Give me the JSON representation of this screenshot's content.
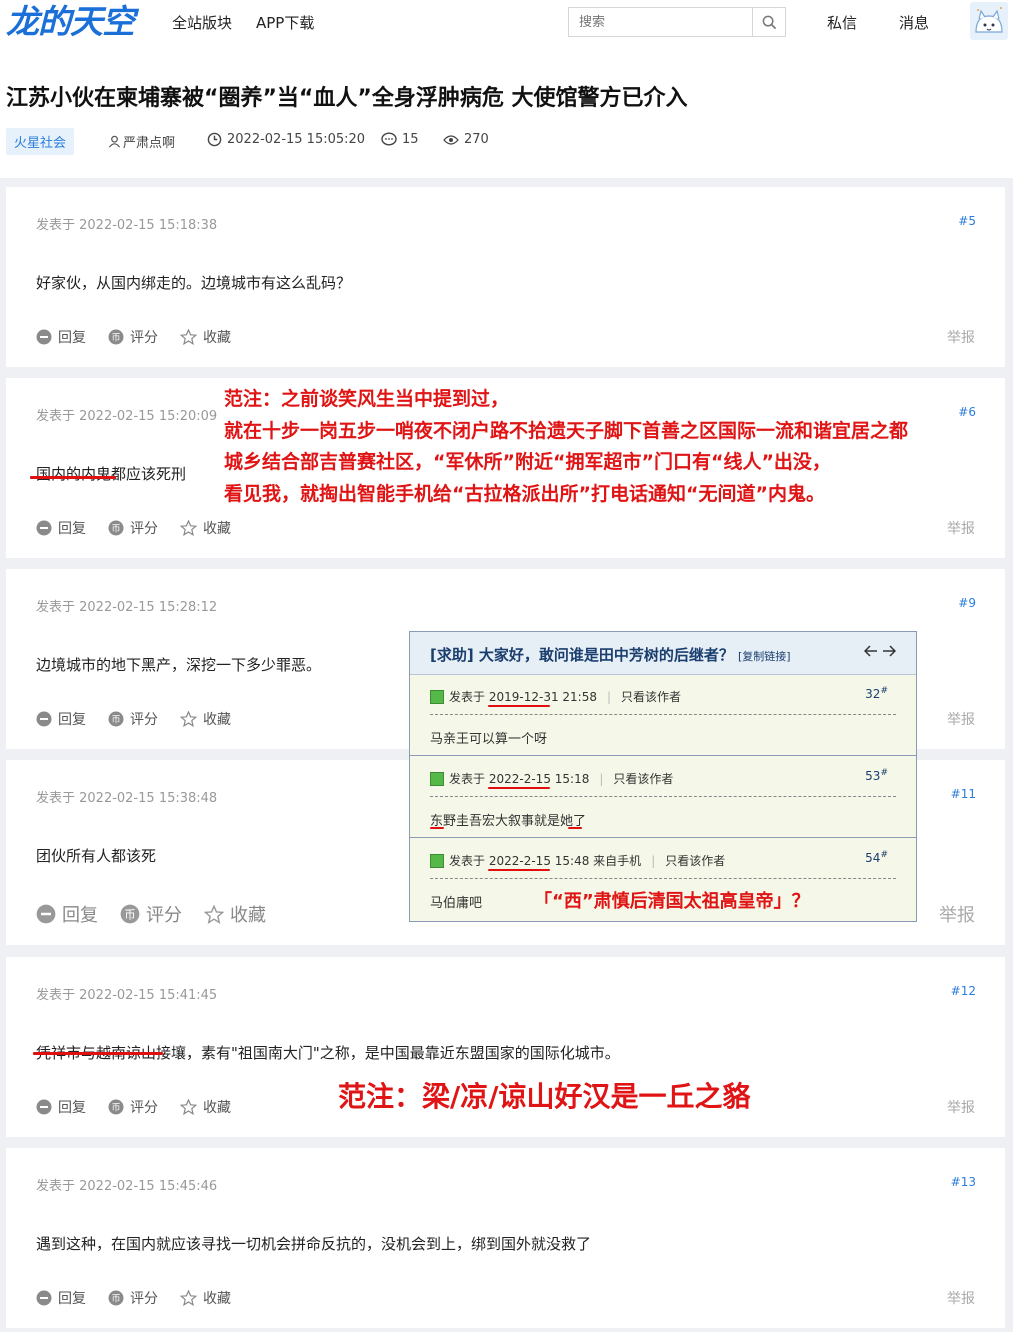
{
  "site": {
    "logo": "龙的天空",
    "nav": [
      "全站版块",
      "APP下载"
    ],
    "search_placeholder": "搜索",
    "top_links": [
      "私信",
      "消息"
    ]
  },
  "thread": {
    "title": "江苏小伙在柬埔寨被“圈养”当“血人”全身浮肿病危 大使馆警方已介入",
    "tag": "火星社会",
    "author": "严肃点啊",
    "time": "2022-02-15 15:05:20",
    "comments": "15",
    "views": "270"
  },
  "actions": {
    "reply": "回复",
    "rate": "评分",
    "fav": "收藏",
    "report": "举报"
  },
  "posts": [
    {
      "time": "发表于 2022-02-15 15:18:38",
      "floor": "#5",
      "content": "好家伙，从国内绑走的。边境城市有这么乱码？"
    },
    {
      "time": "发表于 2022-02-15 15:20:09",
      "floor": "#6",
      "content": "国内的内鬼都应该死刑"
    },
    {
      "time": "发表于 2022-02-15 15:28:12",
      "floor": "#9",
      "content": "边境城市的地下黑产，深挖一下多少罪恶。"
    },
    {
      "time": "发表于 2022-02-15 15:38:48",
      "floor": "#11",
      "content": "团伙所有人都该死"
    },
    {
      "time": "发表于 2022-02-15 15:41:45",
      "floor": "#12",
      "content": "凭祥市与越南谅山接壤，素有\"祖国南大门\"之称，是中国最靠近东盟国家的国际化城市。"
    },
    {
      "time": "发表于 2022-02-15 15:45:46",
      "floor": "#13",
      "content": "遇到这种，在国内就应该寻找一切机会拼命反抗的，没机会到上，绑到国外就没救了"
    }
  ],
  "notes": {
    "note1": [
      "范注：之前谈笑风生当中提到过，",
      "就在十步一岗五步一哨夜不闭户路不拾遗天子脚下首善之区国际一流和谐宜居之都",
      "城乡结合部吉普赛社区，“军休所”附近“拥军超市”门口有“线人”出没，",
      "看见我，就掏出智能手机给“古拉格派出所”打电话通知“无间道”内鬼。"
    ],
    "note2": "范注：梁/凉/谅山好汉是一丘之貉",
    "note3": "「“西”肃慎后清国太祖高皇帝」？"
  },
  "inset": {
    "title": "[求助] 大家好，敢问谁是田中芳树的后继者？",
    "copy_link": "[复制链接]",
    "replies": [
      {
        "posted": "发表于",
        "time": "2019-12-31 21:58",
        "extra": "",
        "author_only": "只看该作者",
        "num": "32",
        "body": "马亲王可以算一个呀"
      },
      {
        "posted": "发表于",
        "time": "2022-2-15 15:18",
        "extra": "",
        "author_only": "只看该作者",
        "num": "53",
        "body": "东野圭吾宏大叙事就是她了"
      },
      {
        "posted": "发表于",
        "time": "2022-2-15 15:48",
        "extra": "来自手机",
        "author_only": "只看该作者",
        "num": "54",
        "body": "马伯庸吧"
      }
    ]
  },
  "colors": {
    "accent": "#2b7ddb",
    "annotation": "#e01414",
    "logo": "#1a6fd8"
  }
}
